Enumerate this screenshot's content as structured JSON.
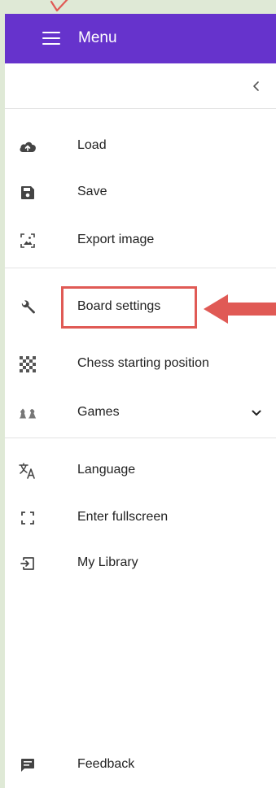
{
  "header": {
    "title": "Menu"
  },
  "menu": {
    "file_items": [
      {
        "label": "Load",
        "icon": "cloud-upload-icon"
      },
      {
        "label": "Save",
        "icon": "save-icon"
      },
      {
        "label": "Export image",
        "icon": "export-image-icon"
      }
    ],
    "board_items": [
      {
        "label": "Board settings",
        "icon": "wrench-icon"
      },
      {
        "label": "Chess starting position",
        "icon": "checkerboard-icon"
      },
      {
        "label": "Games",
        "icon": "chess-pieces-icon"
      }
    ],
    "app_items": [
      {
        "label": "Language",
        "icon": "translate-icon"
      },
      {
        "label": "Enter fullscreen",
        "icon": "fullscreen-icon"
      },
      {
        "label": "My Library",
        "icon": "library-icon"
      }
    ],
    "footer_item": {
      "label": "Feedback",
      "icon": "feedback-icon"
    }
  },
  "colors": {
    "header": "#6633cc",
    "icon": "#444444",
    "annotation": "#e05a55",
    "background": "#dfe9d6"
  }
}
